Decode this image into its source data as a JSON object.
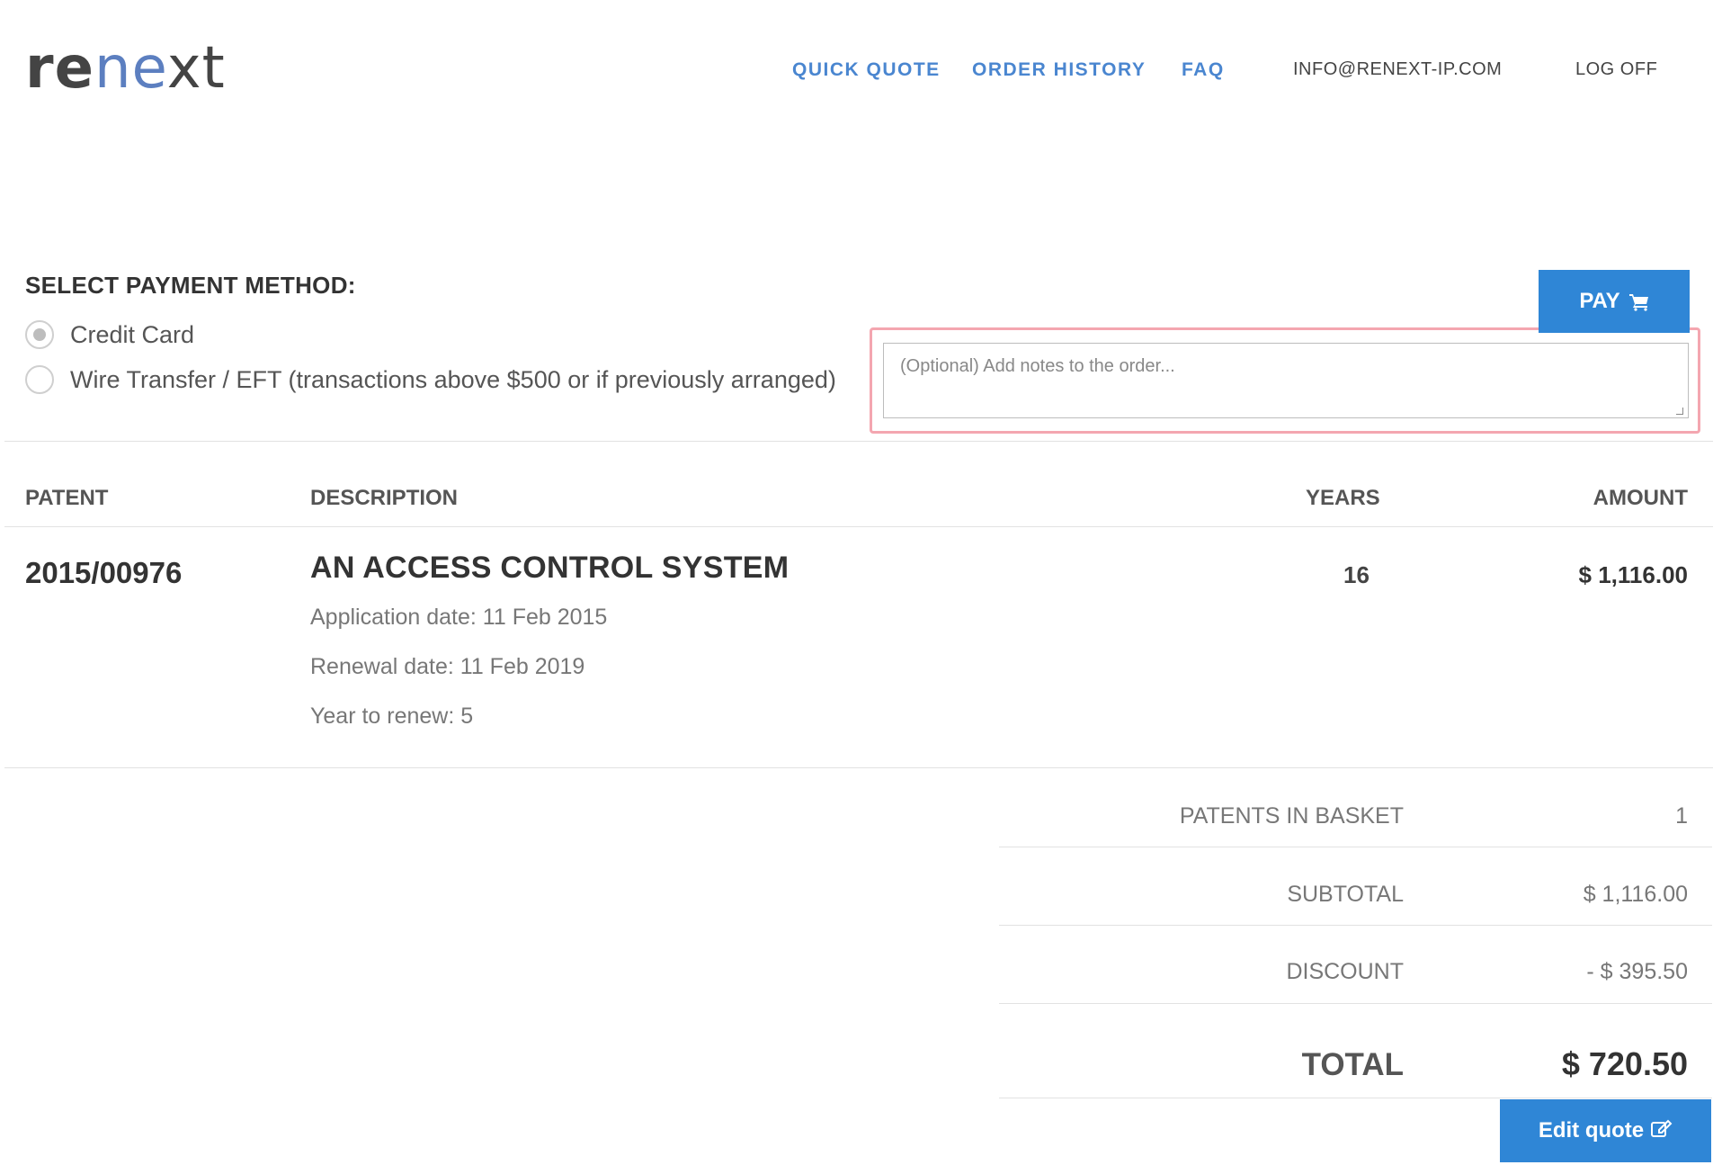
{
  "header": {
    "logo": {
      "part1": "re",
      "part2": "ne",
      "part3": "xt"
    },
    "nav": {
      "quick_quote": "QUICK QUOTE",
      "order_history": "ORDER HISTORY",
      "faq": "FAQ",
      "email": "INFO@RENEXT-IP.COM",
      "log_off": "LOG OFF"
    }
  },
  "payment": {
    "title": "SELECT PAYMENT METHOD:",
    "options": [
      {
        "label": "Credit Card",
        "selected": true
      },
      {
        "label": "Wire Transfer / EFT (transactions above $500 or if previously arranged)",
        "selected": false
      }
    ],
    "pay_label": "PAY",
    "notes_placeholder": "(Optional) Add notes to the order...",
    "notes_value": ""
  },
  "table": {
    "headers": {
      "patent": "PATENT",
      "description": "DESCRIPTION",
      "years": "YEARS",
      "amount": "AMOUNT"
    },
    "rows": [
      {
        "patent": "2015/00976",
        "title": "AN ACCESS CONTROL SYSTEM",
        "application_date": "Application date: 11 Feb 2015",
        "renewal_date": "Renewal date: 11 Feb 2019",
        "year_to_renew": "Year to renew: 5",
        "years": "16",
        "amount": "$ 1,116.00"
      }
    ]
  },
  "summary": {
    "patents_in_basket_label": "PATENTS IN BASKET",
    "patents_in_basket_value": "1",
    "subtotal_label": "SUBTOTAL",
    "subtotal_value": "$ 1,116.00",
    "discount_label": "DISCOUNT",
    "discount_value": "- $ 395.50",
    "total_label": "TOTAL",
    "total_value": "$ 720.50"
  },
  "actions": {
    "edit_quote_label": "Edit quote"
  },
  "colors": {
    "accent": "#2f86d6",
    "nav_link": "#4a86d0",
    "highlight_border": "#f4a6b0"
  }
}
